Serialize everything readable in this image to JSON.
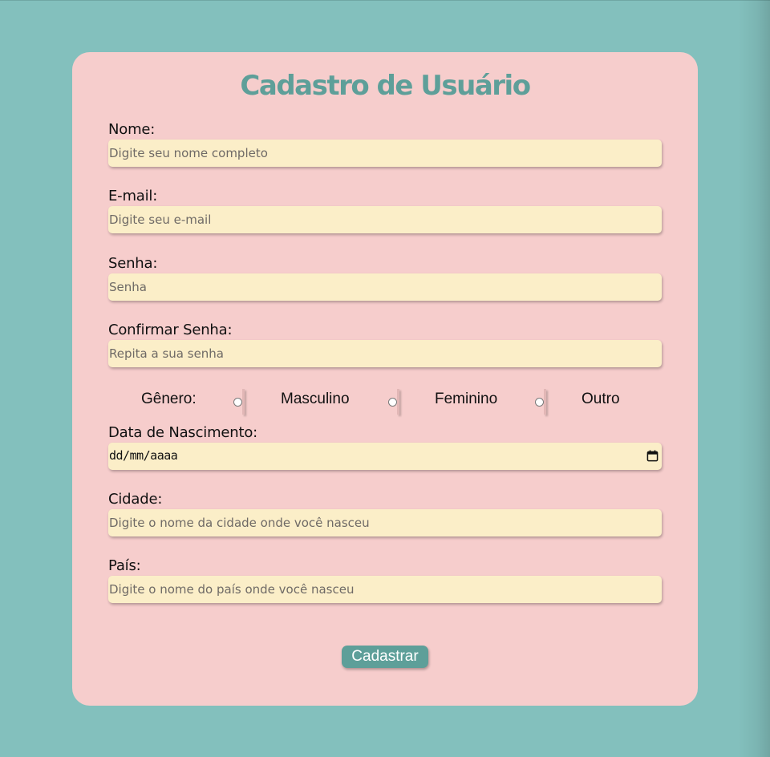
{
  "form": {
    "title": "Cadastro de Usuário",
    "fields": {
      "nome": {
        "label": "Nome:",
        "placeholder": "Digite seu nome completo"
      },
      "email": {
        "label": "E-mail:",
        "placeholder": "Digite seu e-mail"
      },
      "senha": {
        "label": "Senha:",
        "placeholder": "Senha"
      },
      "confirmar": {
        "label": "Confirmar Senha:",
        "placeholder": "Repita a sua senha"
      },
      "nascimento": {
        "label": "Data de Nascimento:",
        "value": "dd/mm/aaaa"
      },
      "cidade": {
        "label": "Cidade:",
        "placeholder": "Digite o nome da cidade onde você nasceu"
      },
      "pais": {
        "label": "País:",
        "placeholder": "Digite o nome do país onde você nasceu"
      }
    },
    "gender": {
      "label": "Gênero:",
      "options": [
        "Masculino",
        "Feminino",
        "Outro"
      ]
    },
    "submit_label": "Cadastrar",
    "icons": {
      "date": "calendar-icon"
    }
  },
  "colors": {
    "page_background": "#83c0bd",
    "card_background": "#f6cdcc",
    "accent": "#5e9f99",
    "input_background": "#fbeec8"
  }
}
